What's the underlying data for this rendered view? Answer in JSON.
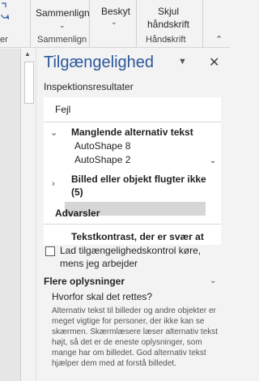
{
  "ribbon": {
    "buttons": [
      {
        "label": "Sammenlign"
      },
      {
        "label": "Beskyt"
      },
      {
        "label_line1": "Skjul",
        "label_line2": "håndskrift"
      }
    ],
    "groups": {
      "left_stub": "er",
      "compare": "Sammenlign",
      "ink": "Håndskrift"
    }
  },
  "pane": {
    "title": "Tilgængelighed",
    "section_label": "Inspektionsresultater",
    "errors_header": "Fejl",
    "missing_alt": "Manglende alternativ tekst",
    "items": [
      "AutoShape 8",
      "AutoShape 2"
    ],
    "floating": "Billed eller objekt flugter ikke",
    "floating_count": "(5)",
    "warnings_header": "Advarsler",
    "contrast": "Tekstkontrast, der er svær at",
    "checkbox_label": "Lad tilgængelighedskontrol køre, mens jeg arbejder",
    "more_title": "Flere oplysninger",
    "why_title": "Hvorfor skal det rettes?",
    "why_body": "Alternativ tekst til billeder og andre objekter er meget vigtige for personer, der ikke kan se skærmen. Skærmlæsere læser alternativ tekst højt, så det er de eneste oplysninger, som mange har om billedet. God alternativ tekst hjælper dem med at forstå billedet."
  }
}
